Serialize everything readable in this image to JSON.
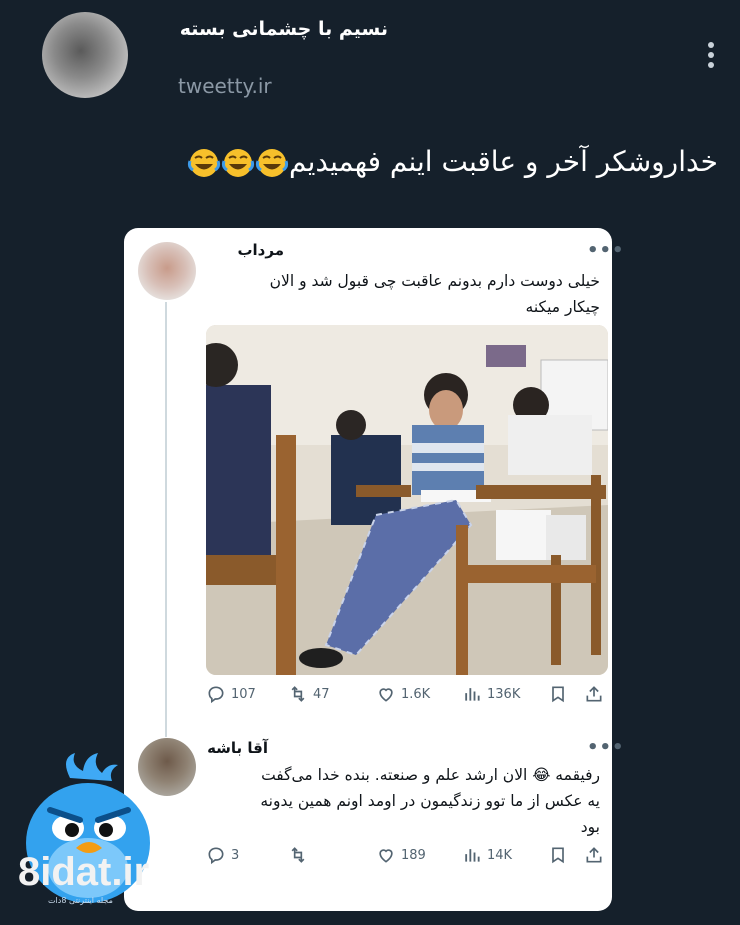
{
  "header": {
    "author_name": "نسیم با چشمانی بسته",
    "handle": "tweetty.ir"
  },
  "tweet": {
    "text": "خداروشکر آخر و عاقبت اینم فهمیدیم",
    "emoji": [
      "laughing-tears-emoji",
      "laughing-tears-emoji",
      "laughing-tears-emoji"
    ]
  },
  "quoted_tweet": {
    "author_name": "مرداب",
    "text_line1": "خیلی دوست دارم بدونم عاقبت چی قبول شد و الان",
    "text_line2": "چیکار میکنه",
    "stats": {
      "replies": "107",
      "retweets": "47",
      "likes": "1.6K",
      "views": "136K"
    }
  },
  "reply": {
    "author_name": "آقا باشه",
    "text_line1": "رفیقمه 😂 الان ارشد علم و صنعته. بنده خدا می‌گفت",
    "text_line2": "یه عکس از ما توو زندگیمون در اومد اونم همین یدونه",
    "text_line3": "بود",
    "stats": {
      "replies": "3",
      "retweets": "",
      "likes": "189",
      "views": "14K"
    }
  },
  "watermark": {
    "logo_text": "8idat.ir",
    "tagline": "مجله اینترنتی 8دات"
  },
  "colors": {
    "background": "#15202b",
    "card": "#ffffff",
    "muted": "#536471"
  }
}
